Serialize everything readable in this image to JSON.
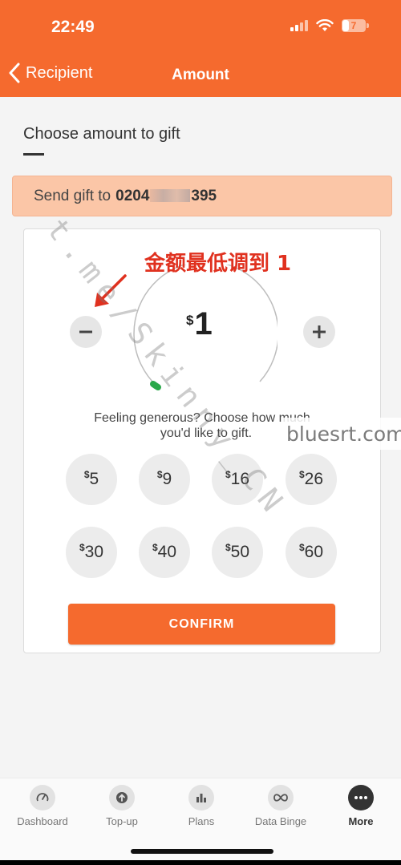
{
  "status": {
    "time": "22:49",
    "battery": "7"
  },
  "nav": {
    "back_label": "Recipient",
    "title": "Amount"
  },
  "section": {
    "title": "Choose amount to gift"
  },
  "send": {
    "prefix": "Send gift to",
    "number_start": "0204",
    "number_end": "395"
  },
  "annotation": {
    "text": "金额最低调到 1"
  },
  "amount": {
    "currency": "$",
    "value": "1"
  },
  "prompt": {
    "line1": "Feeling generous? Choose how much",
    "line2": "you'd like to gift."
  },
  "presets": [
    {
      "currency": "$",
      "value": "5"
    },
    {
      "currency": "$",
      "value": "9"
    },
    {
      "currency": "$",
      "value": "16"
    },
    {
      "currency": "$",
      "value": "26"
    },
    {
      "currency": "$",
      "value": "30"
    },
    {
      "currency": "$",
      "value": "40"
    },
    {
      "currency": "$",
      "value": "50"
    },
    {
      "currency": "$",
      "value": "60"
    }
  ],
  "confirm_label": "CONFIRM",
  "watermarks": {
    "diagonal": "t.me/Skinny_CN",
    "corner": "bluesrt.com"
  },
  "tabs": [
    {
      "label": "Dashboard",
      "icon": "gauge-icon"
    },
    {
      "label": "Top-up",
      "icon": "upload-icon"
    },
    {
      "label": "Plans",
      "icon": "bar-chart-icon"
    },
    {
      "label": "Data Binge",
      "icon": "infinity-icon"
    },
    {
      "label": "More",
      "icon": "more-dots-icon"
    }
  ],
  "colors": {
    "brand": "#f56a2e",
    "send_bar": "#fbc6a7",
    "annotation": "#e0311f",
    "dial_dot": "#2aa84a"
  }
}
